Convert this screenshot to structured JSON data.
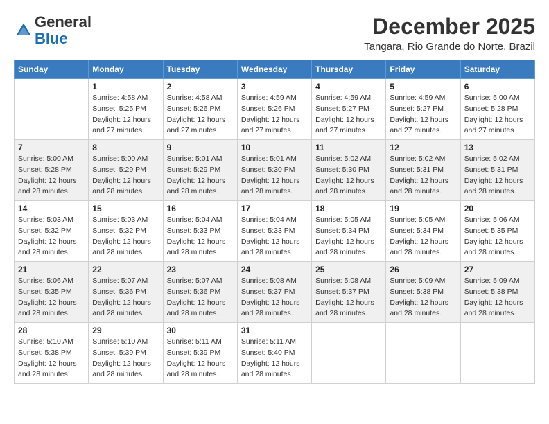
{
  "header": {
    "logo_general": "General",
    "logo_blue": "Blue",
    "month_title": "December 2025",
    "location": "Tangara, Rio Grande do Norte, Brazil"
  },
  "weekdays": [
    "Sunday",
    "Monday",
    "Tuesday",
    "Wednesday",
    "Thursday",
    "Friday",
    "Saturday"
  ],
  "weeks": [
    [
      {
        "day": "",
        "info": ""
      },
      {
        "day": "1",
        "info": "Sunrise: 4:58 AM\nSunset: 5:25 PM\nDaylight: 12 hours\nand 27 minutes."
      },
      {
        "day": "2",
        "info": "Sunrise: 4:58 AM\nSunset: 5:26 PM\nDaylight: 12 hours\nand 27 minutes."
      },
      {
        "day": "3",
        "info": "Sunrise: 4:59 AM\nSunset: 5:26 PM\nDaylight: 12 hours\nand 27 minutes."
      },
      {
        "day": "4",
        "info": "Sunrise: 4:59 AM\nSunset: 5:27 PM\nDaylight: 12 hours\nand 27 minutes."
      },
      {
        "day": "5",
        "info": "Sunrise: 4:59 AM\nSunset: 5:27 PM\nDaylight: 12 hours\nand 27 minutes."
      },
      {
        "day": "6",
        "info": "Sunrise: 5:00 AM\nSunset: 5:28 PM\nDaylight: 12 hours\nand 27 minutes."
      }
    ],
    [
      {
        "day": "7",
        "info": "Sunrise: 5:00 AM\nSunset: 5:28 PM\nDaylight: 12 hours\nand 28 minutes."
      },
      {
        "day": "8",
        "info": "Sunrise: 5:00 AM\nSunset: 5:29 PM\nDaylight: 12 hours\nand 28 minutes."
      },
      {
        "day": "9",
        "info": "Sunrise: 5:01 AM\nSunset: 5:29 PM\nDaylight: 12 hours\nand 28 minutes."
      },
      {
        "day": "10",
        "info": "Sunrise: 5:01 AM\nSunset: 5:30 PM\nDaylight: 12 hours\nand 28 minutes."
      },
      {
        "day": "11",
        "info": "Sunrise: 5:02 AM\nSunset: 5:30 PM\nDaylight: 12 hours\nand 28 minutes."
      },
      {
        "day": "12",
        "info": "Sunrise: 5:02 AM\nSunset: 5:31 PM\nDaylight: 12 hours\nand 28 minutes."
      },
      {
        "day": "13",
        "info": "Sunrise: 5:02 AM\nSunset: 5:31 PM\nDaylight: 12 hours\nand 28 minutes."
      }
    ],
    [
      {
        "day": "14",
        "info": "Sunrise: 5:03 AM\nSunset: 5:32 PM\nDaylight: 12 hours\nand 28 minutes."
      },
      {
        "day": "15",
        "info": "Sunrise: 5:03 AM\nSunset: 5:32 PM\nDaylight: 12 hours\nand 28 minutes."
      },
      {
        "day": "16",
        "info": "Sunrise: 5:04 AM\nSunset: 5:33 PM\nDaylight: 12 hours\nand 28 minutes."
      },
      {
        "day": "17",
        "info": "Sunrise: 5:04 AM\nSunset: 5:33 PM\nDaylight: 12 hours\nand 28 minutes."
      },
      {
        "day": "18",
        "info": "Sunrise: 5:05 AM\nSunset: 5:34 PM\nDaylight: 12 hours\nand 28 minutes."
      },
      {
        "day": "19",
        "info": "Sunrise: 5:05 AM\nSunset: 5:34 PM\nDaylight: 12 hours\nand 28 minutes."
      },
      {
        "day": "20",
        "info": "Sunrise: 5:06 AM\nSunset: 5:35 PM\nDaylight: 12 hours\nand 28 minutes."
      }
    ],
    [
      {
        "day": "21",
        "info": "Sunrise: 5:06 AM\nSunset: 5:35 PM\nDaylight: 12 hours\nand 28 minutes."
      },
      {
        "day": "22",
        "info": "Sunrise: 5:07 AM\nSunset: 5:36 PM\nDaylight: 12 hours\nand 28 minutes."
      },
      {
        "day": "23",
        "info": "Sunrise: 5:07 AM\nSunset: 5:36 PM\nDaylight: 12 hours\nand 28 minutes."
      },
      {
        "day": "24",
        "info": "Sunrise: 5:08 AM\nSunset: 5:37 PM\nDaylight: 12 hours\nand 28 minutes."
      },
      {
        "day": "25",
        "info": "Sunrise: 5:08 AM\nSunset: 5:37 PM\nDaylight: 12 hours\nand 28 minutes."
      },
      {
        "day": "26",
        "info": "Sunrise: 5:09 AM\nSunset: 5:38 PM\nDaylight: 12 hours\nand 28 minutes."
      },
      {
        "day": "27",
        "info": "Sunrise: 5:09 AM\nSunset: 5:38 PM\nDaylight: 12 hours\nand 28 minutes."
      }
    ],
    [
      {
        "day": "28",
        "info": "Sunrise: 5:10 AM\nSunset: 5:38 PM\nDaylight: 12 hours\nand 28 minutes."
      },
      {
        "day": "29",
        "info": "Sunrise: 5:10 AM\nSunset: 5:39 PM\nDaylight: 12 hours\nand 28 minutes."
      },
      {
        "day": "30",
        "info": "Sunrise: 5:11 AM\nSunset: 5:39 PM\nDaylight: 12 hours\nand 28 minutes."
      },
      {
        "day": "31",
        "info": "Sunrise: 5:11 AM\nSunset: 5:40 PM\nDaylight: 12 hours\nand 28 minutes."
      },
      {
        "day": "",
        "info": ""
      },
      {
        "day": "",
        "info": ""
      },
      {
        "day": "",
        "info": ""
      }
    ]
  ]
}
